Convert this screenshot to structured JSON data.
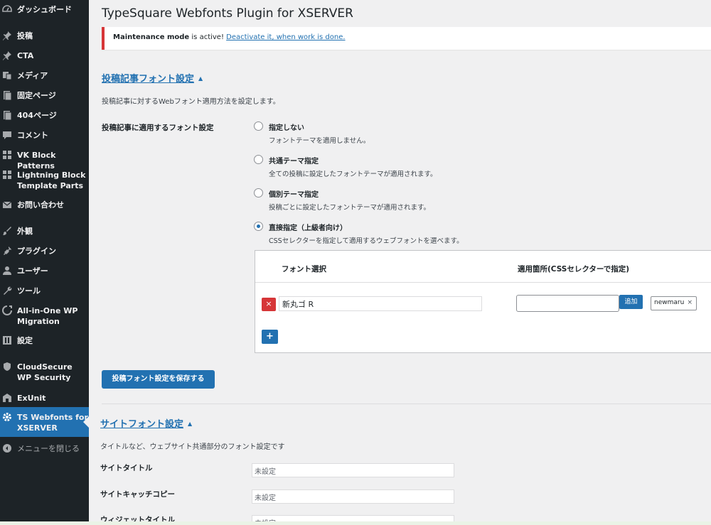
{
  "sidebar": {
    "items": [
      {
        "label": "ダッシュボード",
        "icon": "dashboard-icon"
      },
      {
        "label": "投稿",
        "icon": "pin-icon"
      },
      {
        "label": "CTA",
        "icon": "pin-icon"
      },
      {
        "label": "メディア",
        "icon": "media-icon"
      },
      {
        "label": "固定ページ",
        "icon": "page-icon"
      },
      {
        "label": "404ページ",
        "icon": "page-icon"
      },
      {
        "label": "コメント",
        "icon": "comment-icon"
      },
      {
        "label": "VK Block Patterns",
        "icon": "grid-icon"
      },
      {
        "label": "Lightning Block Template Parts",
        "icon": "grid-icon"
      },
      {
        "label": "お問い合わせ",
        "icon": "mail-icon"
      },
      {
        "label": "外観",
        "icon": "brush-icon"
      },
      {
        "label": "プラグイン",
        "icon": "plugin-icon"
      },
      {
        "label": "ユーザー",
        "icon": "user-icon"
      },
      {
        "label": "ツール",
        "icon": "wrench-icon"
      },
      {
        "label": "All-in-One WP Migration",
        "icon": "migration-icon"
      },
      {
        "label": "設定",
        "icon": "settings-icon"
      },
      {
        "label": "CloudSecure WP Security",
        "icon": "shield-icon"
      },
      {
        "label": "ExUnit",
        "icon": "building-icon"
      },
      {
        "label": "TS Webfonts for XSERVER",
        "icon": "gear-icon"
      },
      {
        "label": "メニューを閉じる",
        "icon": "collapse-icon"
      }
    ]
  },
  "page": {
    "title": "TypeSquare Webfonts Plugin for XSERVER"
  },
  "notice": {
    "text_before": "Maintenance mode",
    "text_middle": " is active! ",
    "link": "Deactivate it, when work is done."
  },
  "post_font": {
    "section_title": "投稿記事フォント設定",
    "toggle": "▲",
    "description": "投稿記事に対するWebフォント適用方法を設定します。",
    "setting_label": "投稿記事に適用するフォント設定",
    "options": [
      {
        "title": "指定しない",
        "desc": "フォントテーマを適用しません。",
        "checked": false
      },
      {
        "title": "共通テーマ指定",
        "desc": "全ての投稿に設定したフォントテーマが適用されます。",
        "checked": false
      },
      {
        "title": "個別テーマ指定",
        "desc": "投稿ごとに設定したフォントテーマが適用されます。",
        "checked": false
      },
      {
        "title": "直接指定（上級者向け）",
        "desc": "CSSセレクターを指定して適用するウェブフォントを選べます。",
        "checked": true
      }
    ],
    "table": {
      "col_font": "フォント選択",
      "col_selector": "適用箇所(CSSセレクターで指定)",
      "remove": "×",
      "font_value": "新丸ゴ R",
      "selector_value": "",
      "add_label": "追加",
      "tag": "newmaru",
      "tag_remove": "×",
      "plus": "+"
    },
    "save_label": "投稿フォント設定を保存する"
  },
  "site_font": {
    "section_title": "サイトフォント設定",
    "toggle": "▲",
    "description": "タイトルなど、ウェブサイト共通部分のフォント設定です",
    "rows": [
      {
        "label": "サイトタイトル",
        "value": "未設定"
      },
      {
        "label": "サイトキャッチコピー",
        "value": "未設定"
      },
      {
        "label": "ウィジェットタイトル",
        "value": "未設定"
      }
    ]
  },
  "colors": {
    "sidebar_bg": "#1d2327",
    "accent": "#2271b1",
    "notice_border": "#d63638"
  }
}
